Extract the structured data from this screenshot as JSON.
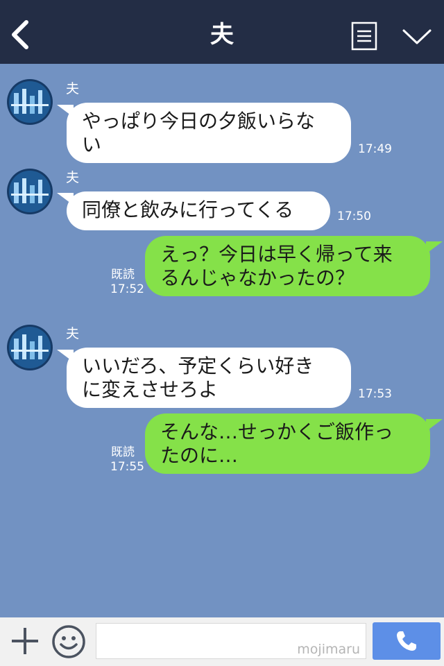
{
  "header": {
    "title": "夫",
    "icons": [
      "back-icon",
      "menu-icon",
      "chevron-down-icon"
    ]
  },
  "colors": {
    "header_bg": "#232d45",
    "chat_bg": "#7292c2",
    "incoming_bubble": "#ffffff",
    "outgoing_bubble": "#85e149",
    "call_button": "#5d8fe7"
  },
  "messages": [
    {
      "direction": "in",
      "sender": "夫",
      "text": "やっぱり今日の夕飯いらな\nい",
      "time": "17:49"
    },
    {
      "direction": "in",
      "sender": "夫",
      "text": "同僚と飲みに行ってくる",
      "time": "17:50"
    },
    {
      "direction": "out",
      "read": "既読",
      "text": "えっ？今日は早く帰って来\nるんじゃなかったの？",
      "time": "17:52"
    },
    {
      "direction": "in",
      "sender": "夫",
      "text": "いいだろ、予定くらい好き\nに変えさせろよ",
      "time": "17:53"
    },
    {
      "direction": "out",
      "read": "既読",
      "text": "そんな…せっかくご飯作っ\nたのに…",
      "time": "17:55"
    }
  ],
  "footer": {
    "input_value": "",
    "watermark": "mojimaru",
    "icons": [
      "plus-icon",
      "smile-icon",
      "phone-icon"
    ]
  }
}
